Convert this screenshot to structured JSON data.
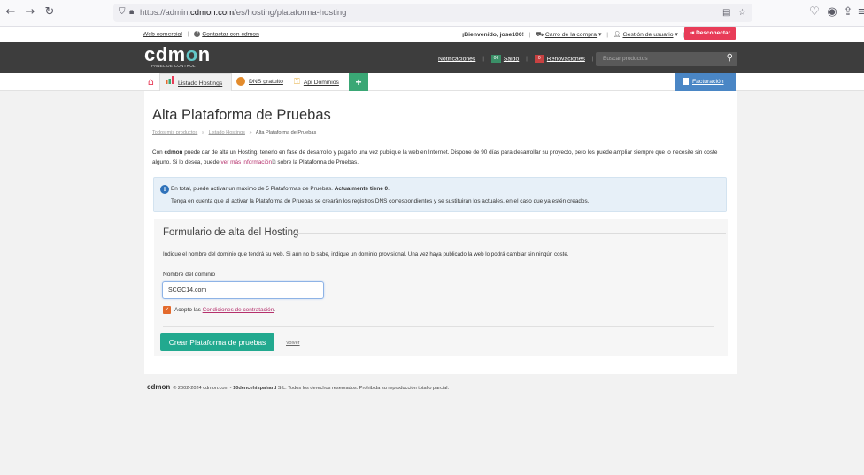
{
  "browser": {
    "url_prefix": "https://admin.",
    "url_domain": "cdmon.com",
    "url_suffix": "/es/hosting/plataforma-hosting"
  },
  "topbar": {
    "web_comercial": "Web comercial",
    "contactar": "Contactar con cdmon",
    "bienvenido": "¡Bienvenido, jose100!",
    "carro": "Carro de la compra",
    "gestion": "Gestión de usuario",
    "desconectar": "Desconectar"
  },
  "header": {
    "logo_main": "cdm",
    "logo_o": "o",
    "logo_n": "n",
    "logo_sub": "PANEL DE CONTROL",
    "notificaciones": "Notificaciones",
    "saldo_chip": "0€",
    "saldo": "Saldo",
    "renov_chip": "0",
    "renovaciones": "Renovaciones",
    "search_placeholder": "Buscar productos"
  },
  "nav": {
    "tabs": [
      "Listado Hostings",
      "DNS gratuito",
      "Api Dominios"
    ],
    "plus": "+",
    "facturacion": "Facturación"
  },
  "page": {
    "title": "Alta Plataforma de Pruebas",
    "breadcrumb": [
      "Todos mis productos",
      "Listado Hostings",
      "Alta Plataforma de Pruebas"
    ],
    "breadcrumb_sep": "»",
    "intro_pre": "Con ",
    "intro_bold": "cdmon",
    "intro_mid": " puede dar de alta un Hosting, tenerlo en fase de desarrollo y pagarlo una vez publique la web en Internet. Dispone de 90 días para desarrollar su proyecto, pero los puede ampliar siempre que lo necesite sin coste alguno. Si lo desea, puede ",
    "intro_link": "ver más información",
    "intro_post": " sobre la Plataforma de Pruebas.",
    "info_line1": "En total, puede activar un máximo de 5 Plataformas de Pruebas. ",
    "info_line1_bold": "Actualmente tiene 0",
    "info_line1_end": ".",
    "info_line2": "Tenga en cuenta que al activar la Plataforma de Pruebas se crearán los registros DNS correspondientes y se sustituirán los actuales, en el caso que ya estén creados."
  },
  "form": {
    "title": "Formulario de alta del Hosting",
    "description": "Indique el nombre del dominio que tendrá su web. Si aún no lo sabe, indique un dominio provisional. Una vez haya publicado la web lo podrá cambiar sin ningún coste.",
    "domain_label": "Nombre del dominio",
    "domain_value": "SCGC14.com",
    "accept_pre": "Acepto las ",
    "accept_link": "Condiciones de contratación",
    "accept_post": ".",
    "accept_checked": true,
    "submit": "Crear Plataforma de pruebas",
    "back": "Volver"
  },
  "footer": {
    "logo": "cdmon",
    "text_pre": "© 2002-2024 cdmon.com - ",
    "company": "10dencehispahard",
    "text_post": " S.L. Todos los derechos reservados. Prohibida su reproducción total o parcial."
  },
  "colors": {
    "accent_red": "#e83c58",
    "teal_button": "#22a98f",
    "header_dark": "#3d3d3d",
    "info_bg": "#e7f0f8"
  }
}
